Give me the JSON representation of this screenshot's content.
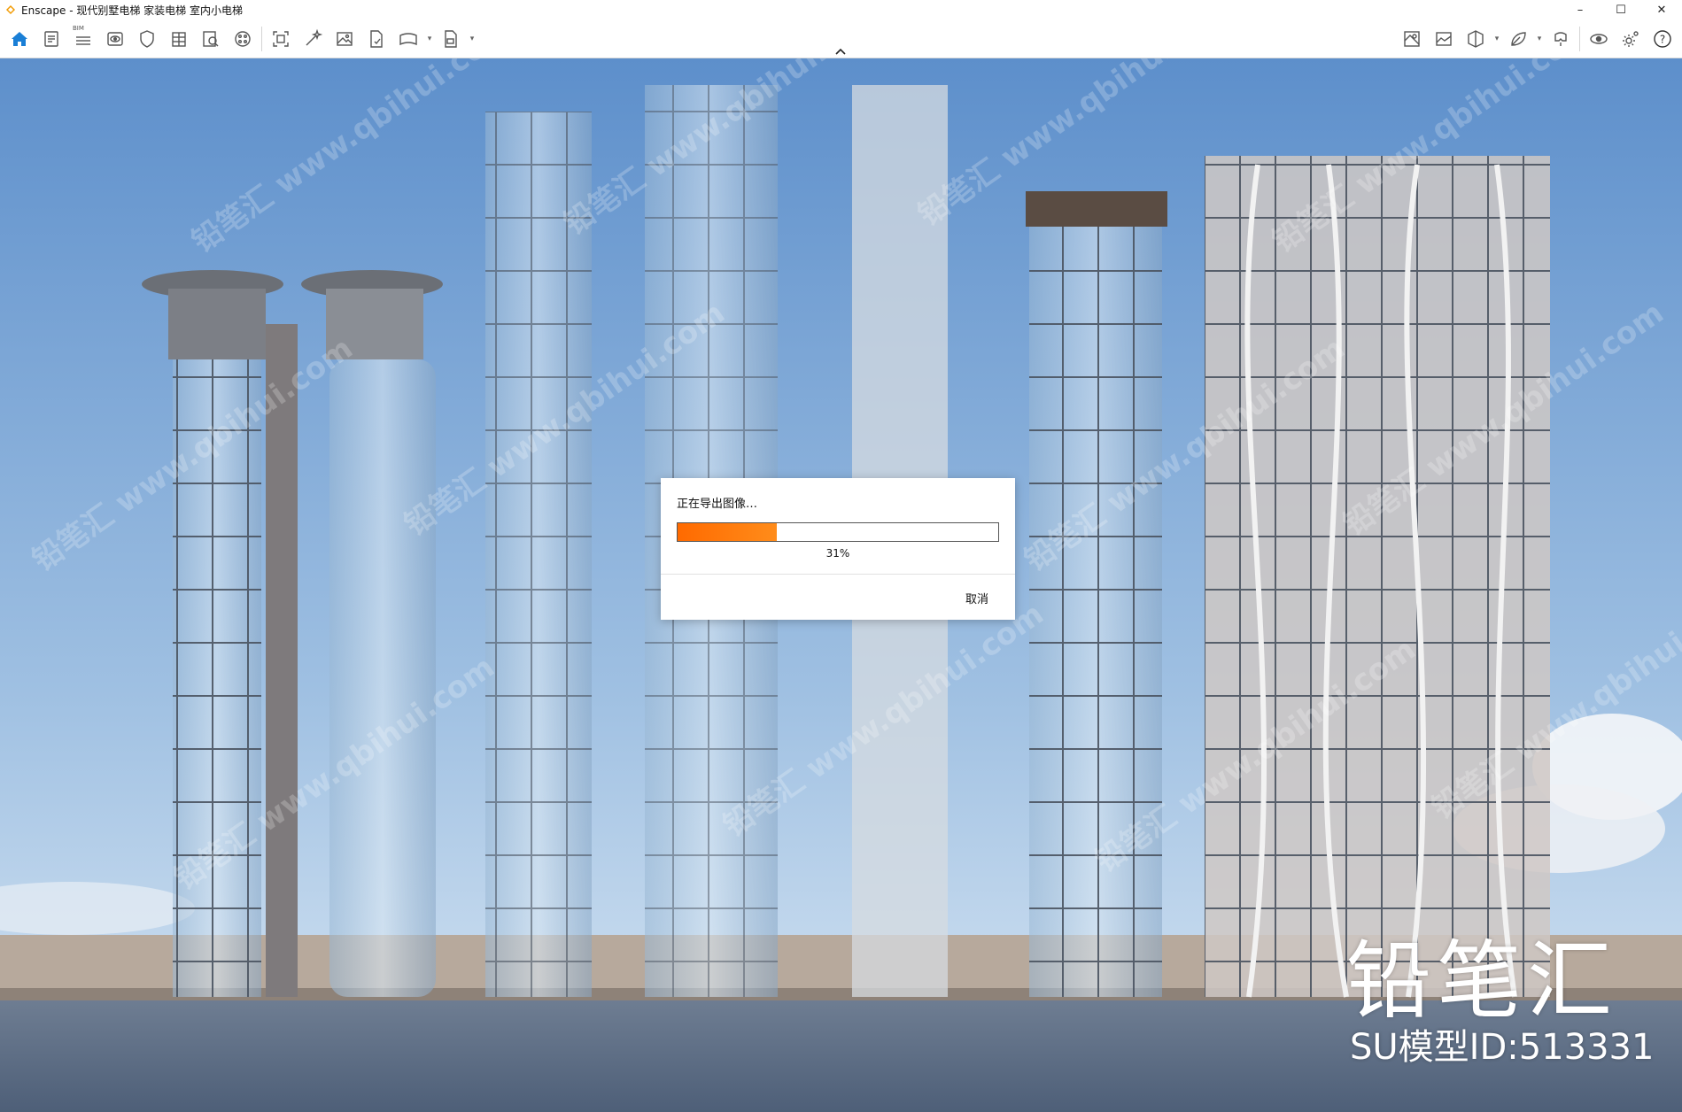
{
  "window": {
    "title": "Enscape - 现代别墅电梯 家装电梯 室内小电梯",
    "controls": {
      "minimize": "–",
      "maximize": "☐",
      "close": "✕"
    }
  },
  "toolbar": {
    "bim_label": "BIM",
    "left_icons": [
      "home-icon",
      "document-icon",
      "bim-list-icon",
      "eye-view-icon",
      "shield-icon",
      "building-icon",
      "search-doc-icon",
      "palette-icon",
      "screenshot-icon",
      "magic-wand-icon",
      "image-icon",
      "export-file-icon",
      "panorama-icon",
      "video-export-icon"
    ],
    "right_icons": [
      "map-icon",
      "gallery-icon",
      "cube-icon",
      "leaf-icon",
      "vr-headset-icon",
      "visibility-icon",
      "settings-icon",
      "help-icon"
    ],
    "help_label": "?"
  },
  "dialog": {
    "title": "正在导出图像…",
    "progress": 31,
    "progress_label": "31%",
    "cancel_label": "取消"
  },
  "watermark": {
    "brand": "铅笔汇",
    "model_id": "SU模型ID:513331",
    "tiles": [
      "铅笔汇 www.qbihui.com",
      "铅笔汇 www.qbihui.com",
      "铅笔汇 www.qbihui.com",
      "铅笔汇 www.qbihui.com",
      "铅笔汇 www.qbihui.com",
      "铅笔汇 www.qbihui.com",
      "铅笔汇 www.qbihui.com",
      "铅笔汇 www.qbihui.com",
      "铅笔汇 www.qbihui.com",
      "铅笔汇 www.qbihui.com",
      "铅笔汇 www.qbihui.com",
      "铅笔汇 www.qbihui.com"
    ]
  },
  "colors": {
    "accent": "#1a7fd6",
    "progress": "#ff6a00",
    "sky_top": "#5d8fcb",
    "sky_bottom": "#d9e7f4"
  }
}
